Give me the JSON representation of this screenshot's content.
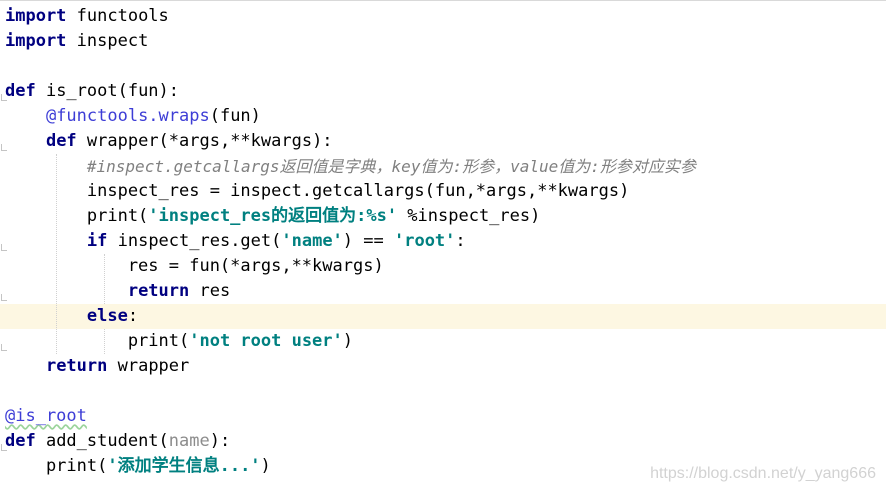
{
  "editor": {
    "lines": [
      [
        {
          "t": "import",
          "c": "kw"
        },
        {
          "t": " functools",
          "c": ""
        }
      ],
      [
        {
          "t": "import",
          "c": "kw"
        },
        {
          "t": " inspect",
          "c": ""
        }
      ],
      [],
      [
        {
          "t": "def",
          "c": "kw"
        },
        {
          "t": " is_root(fun):",
          "c": ""
        }
      ],
      [
        {
          "t": "    ",
          "c": ""
        },
        {
          "t": "@functools.wraps",
          "c": "deco"
        },
        {
          "t": "(fun)",
          "c": ""
        }
      ],
      [
        {
          "t": "    ",
          "c": ""
        },
        {
          "t": "def",
          "c": "kw"
        },
        {
          "t": " wrapper(*args,**kwargs):",
          "c": ""
        }
      ],
      [
        {
          "t": "        ",
          "c": ""
        },
        {
          "t": "#inspect.getcallargs返回值是字典，key值为:形参，value值为:形参对应实参",
          "c": "cm"
        }
      ],
      [
        {
          "t": "        inspect_res = inspect.getcallargs(fun,*args,**kwargs)",
          "c": ""
        }
      ],
      [
        {
          "t": "        print(",
          "c": ""
        },
        {
          "t": "'inspect_res的返回值为:%s'",
          "c": "str"
        },
        {
          "t": " %inspect_res)",
          "c": ""
        }
      ],
      [
        {
          "t": "        ",
          "c": ""
        },
        {
          "t": "if",
          "c": "kw"
        },
        {
          "t": " inspect_res.get(",
          "c": ""
        },
        {
          "t": "'name'",
          "c": "str"
        },
        {
          "t": ") == ",
          "c": ""
        },
        {
          "t": "'root'",
          "c": "str"
        },
        {
          "t": ":",
          "c": ""
        }
      ],
      [
        {
          "t": "            res = fun(*args,**kwargs)",
          "c": ""
        }
      ],
      [
        {
          "t": "            ",
          "c": ""
        },
        {
          "t": "return",
          "c": "kw"
        },
        {
          "t": " res",
          "c": ""
        }
      ],
      [
        {
          "t": "        ",
          "c": ""
        },
        {
          "t": "else",
          "c": "kw"
        },
        {
          "t": ":",
          "c": ""
        }
      ],
      [
        {
          "t": "            print(",
          "c": ""
        },
        {
          "t": "'not root user'",
          "c": "str"
        },
        {
          "t": ")",
          "c": ""
        }
      ],
      [
        {
          "t": "    ",
          "c": ""
        },
        {
          "t": "return",
          "c": "kw"
        },
        {
          "t": " wrapper",
          "c": ""
        }
      ],
      [],
      [
        {
          "t": "@is_root",
          "c": "deco"
        }
      ],
      [
        {
          "t": "def",
          "c": "kw"
        },
        {
          "t": " add_student(",
          "c": ""
        },
        {
          "t": "name",
          "c": "param"
        },
        {
          "t": "):",
          "c": ""
        }
      ],
      [
        {
          "t": "    print(",
          "c": ""
        },
        {
          "t": "'添加学生信息...'",
          "c": "str"
        },
        {
          "t": ")",
          "c": ""
        }
      ]
    ]
  },
  "watermark": "https://blog.csdn.net/y_yang666"
}
